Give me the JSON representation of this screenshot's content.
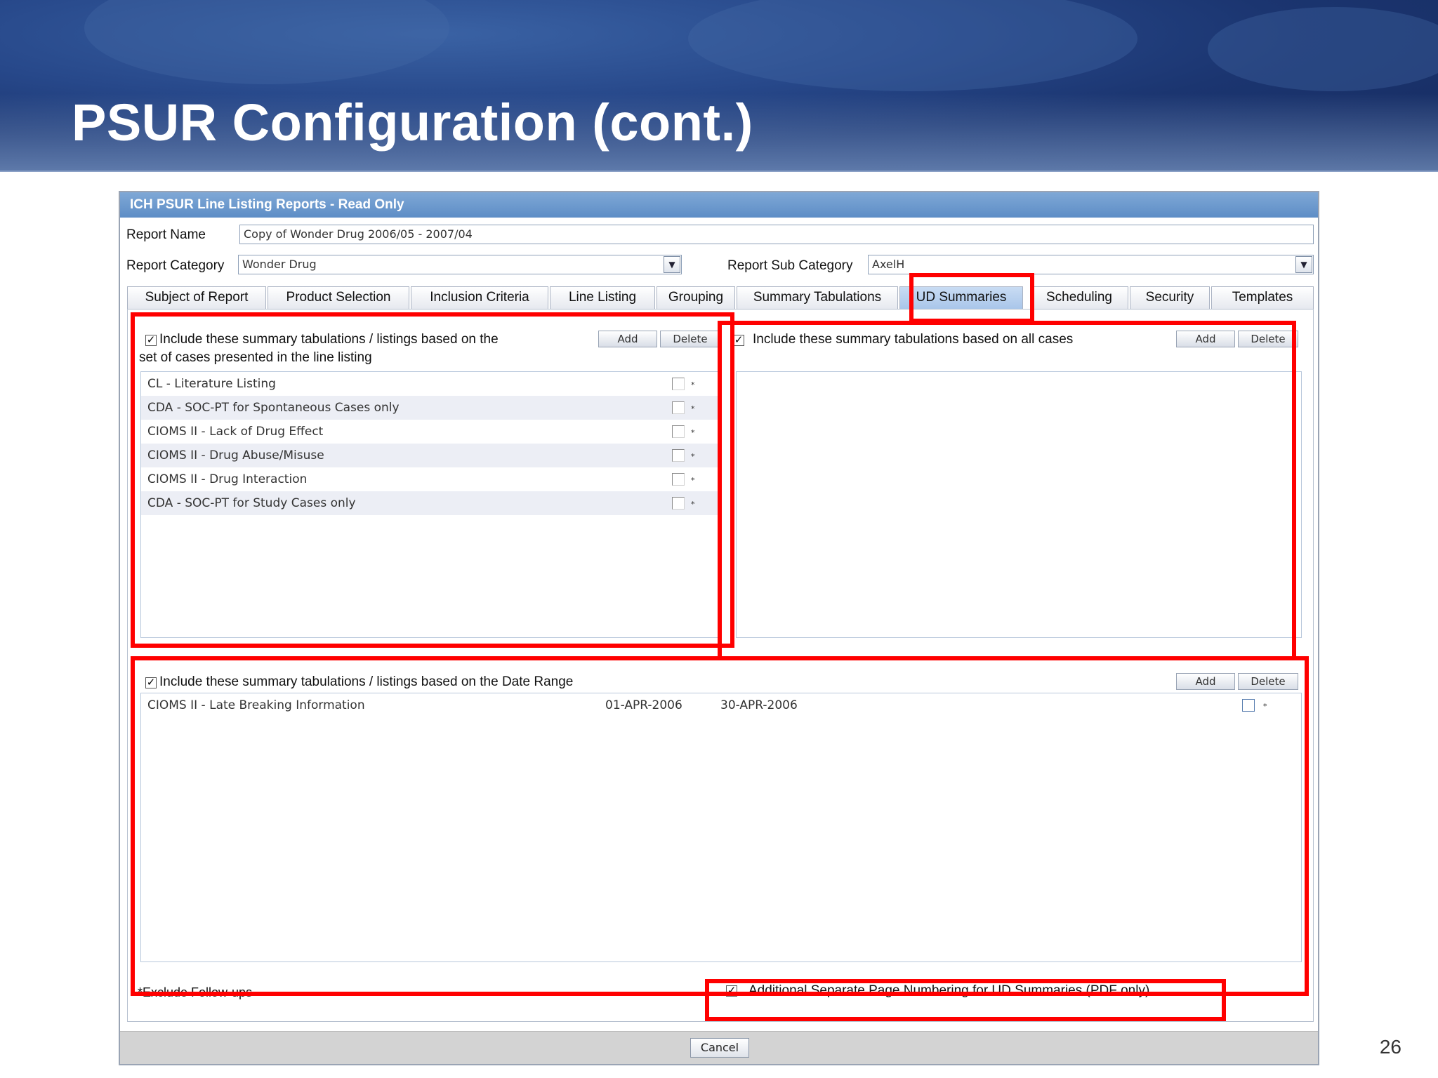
{
  "slide": {
    "title": "PSUR Configuration (cont.)",
    "page_number": "26"
  },
  "dialog": {
    "title": "ICH PSUR Line Listing Reports - Read Only",
    "report_name_label": "Report Name",
    "report_name_value": "Copy of Wonder Drug 2006/05 - 2007/04",
    "report_category_label": "Report Category",
    "report_category_value": "Wonder Drug",
    "report_sub_category_label": "Report Sub Category",
    "report_sub_category_value": "AxelH",
    "tabs": [
      "Subject of Report",
      "Product Selection",
      "Inclusion Criteria",
      "Line Listing",
      "Grouping",
      "Summary Tabulations",
      "UD Summaries",
      "Scheduling",
      "Security",
      "Templates"
    ],
    "active_tab": "UD Summaries",
    "line_listing_panel": {
      "checked": true,
      "heading_line1": "Include these summary tabulations / listings based on the",
      "heading_line2": "set of cases presented in the line listing",
      "add_label": "Add",
      "delete_label": "Delete",
      "items": [
        "CL - Literature Listing",
        "CDA - SOC-PT for Spontaneous Cases only",
        "CIOMS II - Lack of Drug Effect",
        "CIOMS II - Drug Abuse/Misuse",
        "CIOMS II - Drug Interaction",
        "CDA - SOC-PT for Study Cases only"
      ],
      "row_marker": "*"
    },
    "all_cases_panel": {
      "checked": true,
      "heading": "Include these summary tabulations based on all cases",
      "add_label": "Add",
      "delete_label": "Delete"
    },
    "date_range_panel": {
      "checked": true,
      "heading": "Include these summary tabulations / listings based on the Date Range",
      "add_label": "Add",
      "delete_label": "Delete",
      "rows": [
        {
          "name": "CIOMS II - Late Breaking Information",
          "start": "01-APR-2006",
          "end": "30-APR-2006",
          "marker": "*"
        }
      ]
    },
    "exclude_follow_ups_label": "*Exclude Follow-ups",
    "separate_numbering": {
      "checked": true,
      "label": "Additional Separate Page Numbering for UD Summaries (PDF only)"
    },
    "cancel_label": "Cancel"
  },
  "colors": {
    "highlight": "#ff0000",
    "title_bar": "#5d8dc6",
    "active_tab": "#a9c6ea",
    "alt_row": "#eceef5"
  }
}
